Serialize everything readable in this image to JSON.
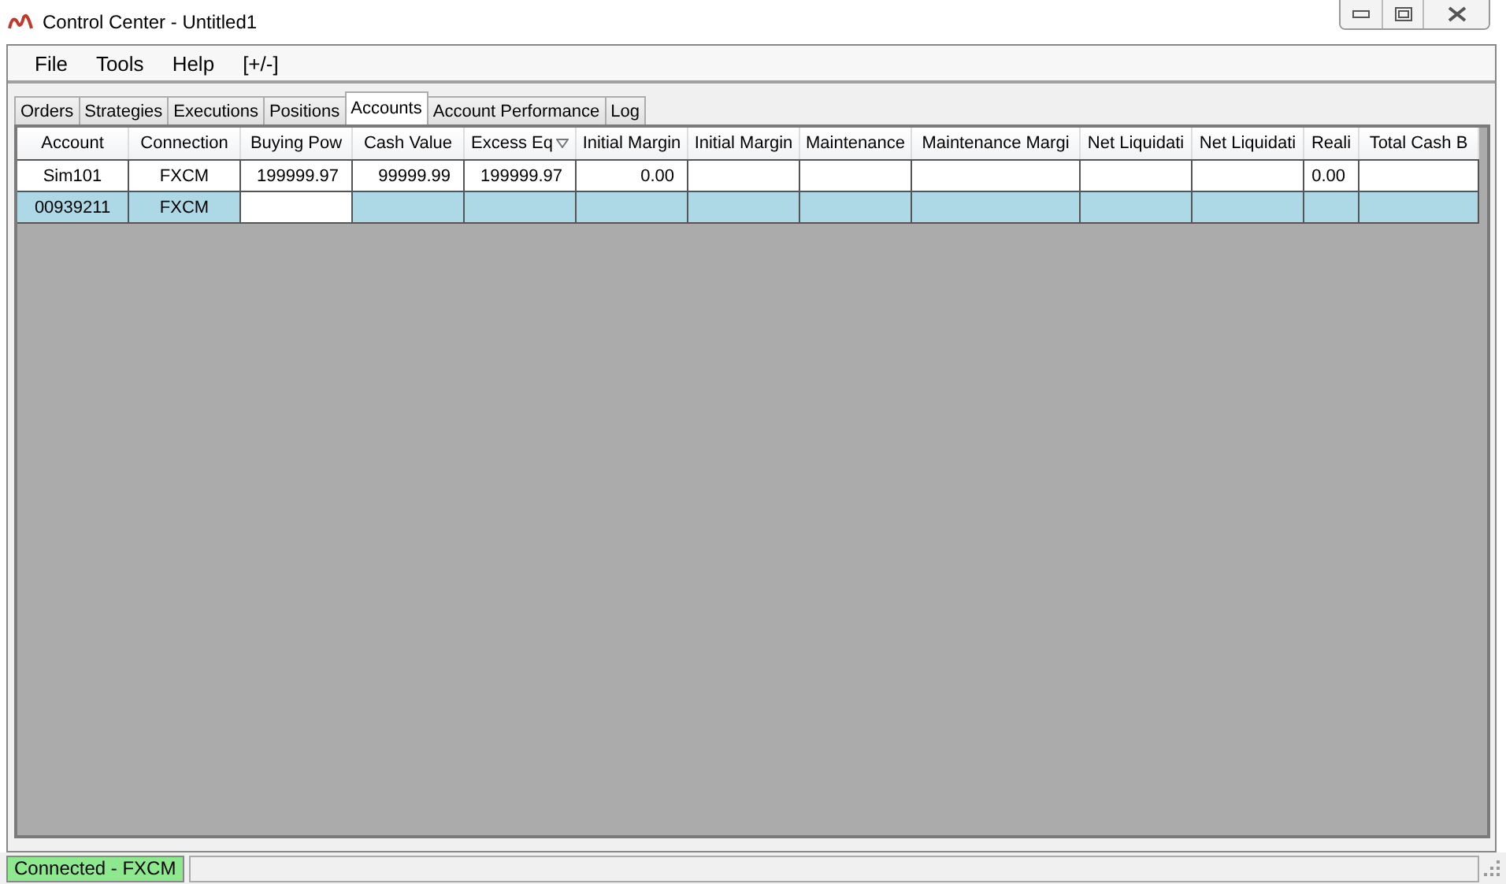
{
  "window": {
    "title": "Control Center - Untitled1"
  },
  "menu": [
    "File",
    "Tools",
    "Help",
    "[+/-]"
  ],
  "tabs": [
    {
      "label": "Orders",
      "selected": false
    },
    {
      "label": "Strategies",
      "selected": false
    },
    {
      "label": "Executions",
      "selected": false
    },
    {
      "label": "Positions",
      "selected": false
    },
    {
      "label": "Accounts",
      "selected": true
    },
    {
      "label": "Account Performance",
      "selected": false
    },
    {
      "label": "Log",
      "selected": false
    }
  ],
  "table": {
    "columns": [
      {
        "label": "Account",
        "sorted": false
      },
      {
        "label": "Connection",
        "sorted": false
      },
      {
        "label": "Buying Pow",
        "sorted": false
      },
      {
        "label": "Cash Value",
        "sorted": false
      },
      {
        "label": "Excess Eq",
        "sorted": true
      },
      {
        "label": "Initial Margin",
        "sorted": false
      },
      {
        "label": "Initial Margin",
        "sorted": false
      },
      {
        "label": "Maintenance",
        "sorted": false
      },
      {
        "label": "Maintenance Margi",
        "sorted": false
      },
      {
        "label": "Net Liquidati",
        "sorted": false
      },
      {
        "label": "Net Liquidati",
        "sorted": false
      },
      {
        "label": "Reali",
        "sorted": false
      },
      {
        "label": "Total Cash B",
        "sorted": false
      }
    ],
    "rows": [
      {
        "selected": false,
        "cells": [
          "Sim101",
          "FXCM",
          "199999.97",
          "99999.99",
          "199999.97",
          "0.00",
          "",
          "",
          "",
          "",
          "",
          "0.00",
          ""
        ]
      },
      {
        "selected": true,
        "cells": [
          "00939211",
          "FXCM",
          "",
          "",
          "",
          "",
          "",
          "",
          "",
          "",
          "",
          "",
          ""
        ]
      }
    ]
  },
  "status_bar": {
    "connection": "Connected - FXCM"
  }
}
